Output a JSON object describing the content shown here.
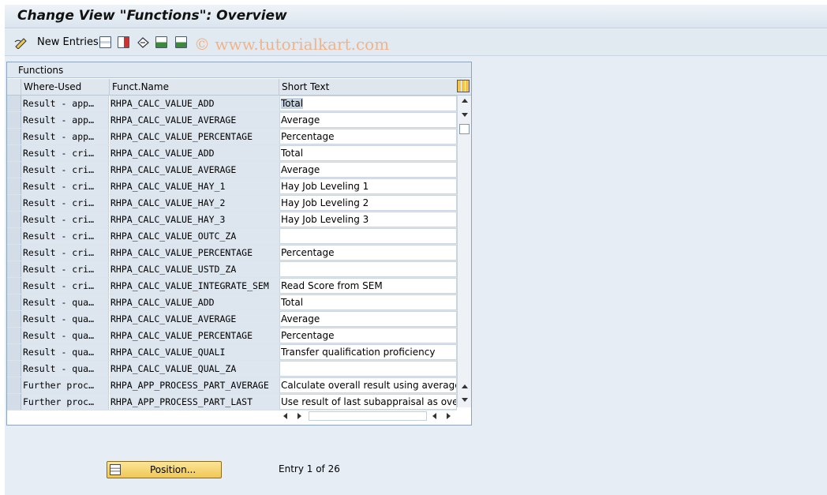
{
  "window": {
    "title": "Change View \"Functions\": Overview"
  },
  "toolbar": {
    "new_entries_label": "New Entries",
    "watermark": "© www.tutorialkart.com",
    "icons": [
      "edit-glasses-icon",
      "copy-icon",
      "delete-icon",
      "undo-icon",
      "select-all-icon",
      "select-block-icon"
    ]
  },
  "table": {
    "title": "Functions",
    "columns": [
      "Where-Used",
      "Funct.Name",
      "Short Text"
    ],
    "rows": [
      {
        "where_used": "Result - app…",
        "funct_name": "RHPA_CALC_VALUE_ADD",
        "short_text": "Total"
      },
      {
        "where_used": "Result - app…",
        "funct_name": "RHPA_CALC_VALUE_AVERAGE",
        "short_text": "Average"
      },
      {
        "where_used": "Result - app…",
        "funct_name": "RHPA_CALC_VALUE_PERCENTAGE",
        "short_text": "Percentage"
      },
      {
        "where_used": "Result - cri…",
        "funct_name": "RHPA_CALC_VALUE_ADD",
        "short_text": "Total"
      },
      {
        "where_used": "Result - cri…",
        "funct_name": "RHPA_CALC_VALUE_AVERAGE",
        "short_text": "Average"
      },
      {
        "where_used": "Result - cri…",
        "funct_name": "RHPA_CALC_VALUE_HAY_1",
        "short_text": "Hay Job Leveling 1"
      },
      {
        "where_used": "Result - cri…",
        "funct_name": "RHPA_CALC_VALUE_HAY_2",
        "short_text": "Hay Job Leveling 2"
      },
      {
        "where_used": "Result - cri…",
        "funct_name": "RHPA_CALC_VALUE_HAY_3",
        "short_text": "Hay Job Leveling 3"
      },
      {
        "where_used": "Result - cri…",
        "funct_name": "RHPA_CALC_VALUE_OUTC_ZA",
        "short_text": ""
      },
      {
        "where_used": "Result - cri…",
        "funct_name": "RHPA_CALC_VALUE_PERCENTAGE",
        "short_text": "Percentage"
      },
      {
        "where_used": "Result - cri…",
        "funct_name": "RHPA_CALC_VALUE_USTD_ZA",
        "short_text": ""
      },
      {
        "where_used": "Result - cri…",
        "funct_name": "RHPA_CALC_VALUE_INTEGRATE_SEM",
        "short_text": "Read Score from SEM"
      },
      {
        "where_used": "Result - qua…",
        "funct_name": "RHPA_CALC_VALUE_ADD",
        "short_text": "Total"
      },
      {
        "where_used": "Result - qua…",
        "funct_name": "RHPA_CALC_VALUE_AVERAGE",
        "short_text": "Average"
      },
      {
        "where_used": "Result - qua…",
        "funct_name": "RHPA_CALC_VALUE_PERCENTAGE",
        "short_text": "Percentage"
      },
      {
        "where_used": "Result - qua…",
        "funct_name": "RHPA_CALC_VALUE_QUALI",
        "short_text": "Transfer qualification proficiency"
      },
      {
        "where_used": "Result - qua…",
        "funct_name": "RHPA_CALC_VALUE_QUAL_ZA",
        "short_text": ""
      },
      {
        "where_used": "Further proc…",
        "funct_name": "RHPA_APP_PROCESS_PART_AVERAGE",
        "short_text": "Calculate overall result using averages"
      },
      {
        "where_used": "Further proc…",
        "funct_name": "RHPA_APP_PROCESS_PART_LAST",
        "short_text": "Use result of last subappraisal as overall re"
      }
    ]
  },
  "footer": {
    "position_button_label": "Position...",
    "entry_info": "Entry 1 of 26"
  }
}
